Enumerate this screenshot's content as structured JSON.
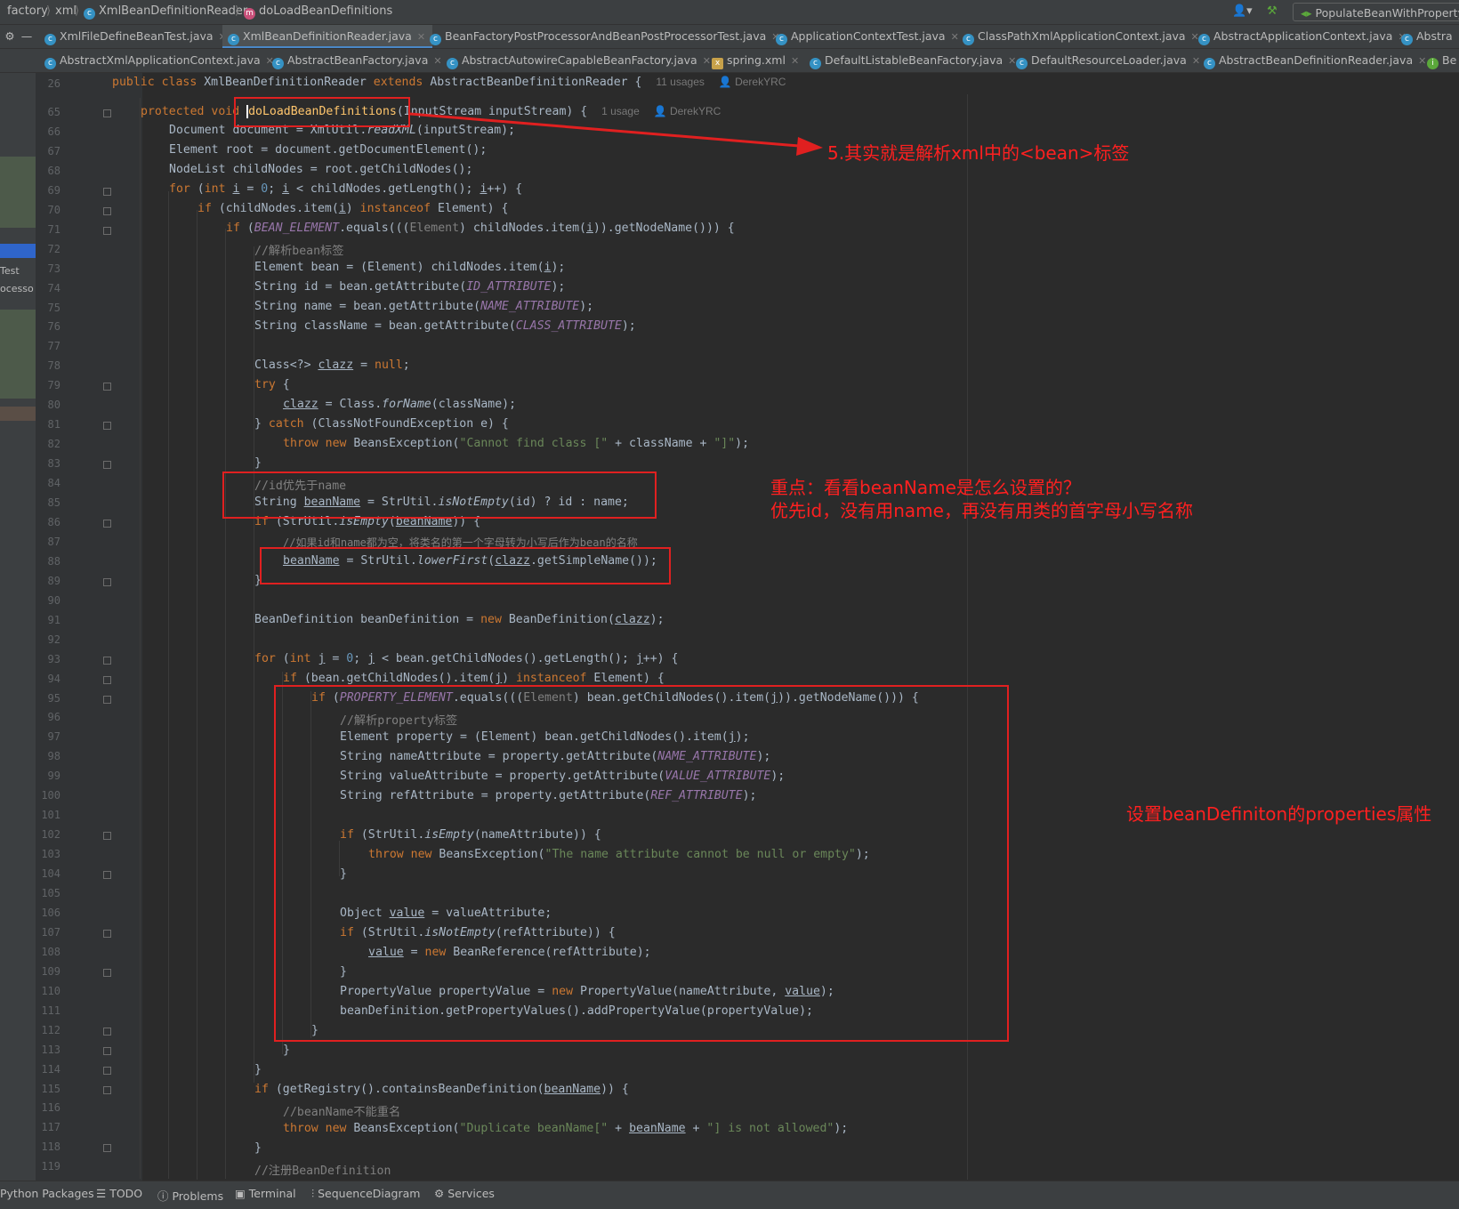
{
  "breadcrumb": [
    "factory",
    "xml",
    "XmlBeanDefinitionReader",
    "doLoadBeanDefinitions"
  ],
  "run_config": "PopulateBeanWithPropertyV",
  "tabs_row1": [
    {
      "label": "XmlFileDefineBeanTest.java",
      "active": false
    },
    {
      "label": "XmlBeanDefinitionReader.java",
      "active": true
    },
    {
      "label": "BeanFactoryPostProcessorAndBeanPostProcessorTest.java",
      "active": false
    },
    {
      "label": "ApplicationContextTest.java",
      "active": false
    },
    {
      "label": "ClassPathXmlApplicationContext.java",
      "active": false
    },
    {
      "label": "AbstractApplicationContext.java",
      "active": false
    },
    {
      "label": "Abstra",
      "active": false
    }
  ],
  "tabs_row2": [
    {
      "label": "AbstractXmlApplicationContext.java"
    },
    {
      "label": "AbstractBeanFactory.java"
    },
    {
      "label": "AbstractAutowireCapableBeanFactory.java"
    },
    {
      "label": "spring.xml"
    },
    {
      "label": "DefaultListableBeanFactory.java"
    },
    {
      "label": "DefaultResourceLoader.java"
    },
    {
      "label": "AbstractBeanDefinitionReader.java"
    },
    {
      "label": "Be"
    }
  ],
  "side_labels": [
    "Test",
    "ocesso"
  ],
  "line_numbers": [
    "26",
    "65",
    "66",
    "67",
    "68",
    "69",
    "70",
    "71",
    "72",
    "73",
    "74",
    "75",
    "76",
    "77",
    "78",
    "79",
    "80",
    "81",
    "82",
    "83",
    "84",
    "85",
    "86",
    "87",
    "88",
    "89",
    "90",
    "91",
    "92",
    "93",
    "94",
    "95",
    "96",
    "97",
    "98",
    "99",
    "100",
    "101",
    "102",
    "103",
    "104",
    "105",
    "106",
    "107",
    "108",
    "109",
    "110",
    "111",
    "112",
    "113",
    "114",
    "115",
    "116",
    "117",
    "118",
    "119"
  ],
  "hints": {
    "class_usages": "11 usages",
    "class_author": "DerekYRC",
    "method_usages": "1 usage",
    "method_author": "DerekYRC"
  },
  "annotations": {
    "method_note": "5.其实就是解析xml中的<bean>标签",
    "beanname_note_1": "重点：看看beanName是怎么设置的？",
    "beanname_note_2": "优先id，没有用name，再没有用类的首字母小写名称",
    "property_note": "设置beanDefiniton的properties属性"
  },
  "bottom_tools": [
    "Python Packages",
    "TODO",
    "Problems",
    "Terminal",
    "SequenceDiagram",
    "Services"
  ],
  "colors": {
    "annotation": "#ff2020",
    "keyword": "#cc7832",
    "method": "#ffc66d",
    "string": "#6a8759",
    "constant": "#9876aa",
    "comment": "#808080"
  }
}
